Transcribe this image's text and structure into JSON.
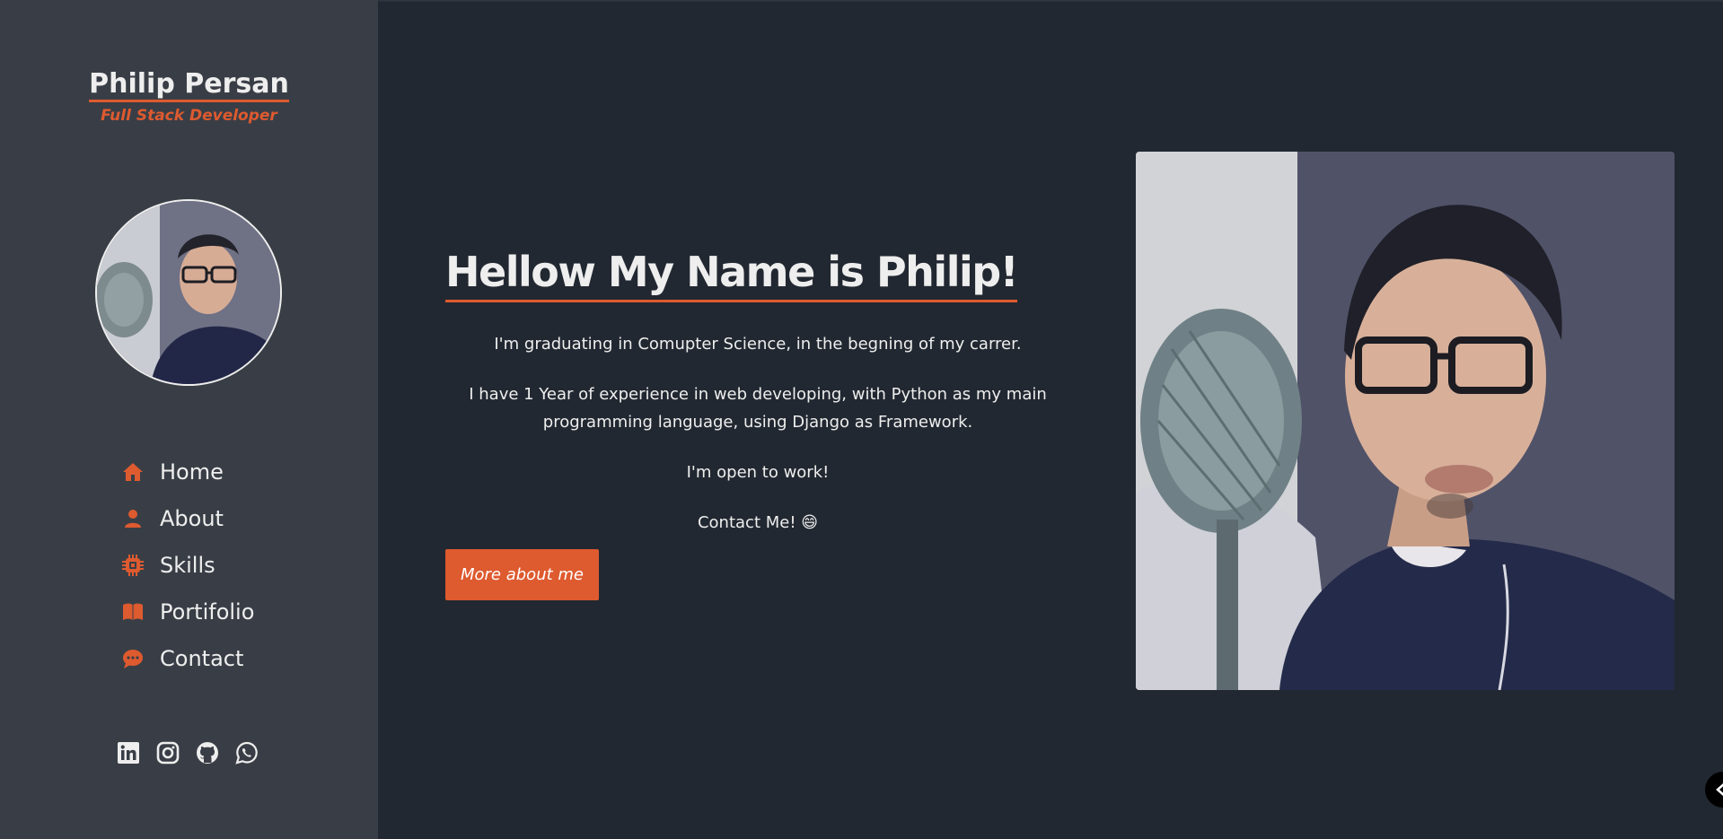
{
  "sidebar": {
    "name": "Philip Persan",
    "role": "Full Stack Developer",
    "nav": [
      {
        "label": "Home",
        "icon": "home-icon"
      },
      {
        "label": "About",
        "icon": "user-icon"
      },
      {
        "label": "Skills",
        "icon": "chip-icon"
      },
      {
        "label": "Portifolio",
        "icon": "book-icon"
      },
      {
        "label": "Contact",
        "icon": "chat-icon"
      }
    ],
    "socials": [
      "linkedin-icon",
      "instagram-icon",
      "github-icon",
      "whatsapp-icon"
    ]
  },
  "hero": {
    "title": "Hellow My Name is Philip!",
    "paragraphs": [
      "I'm graduating in Comupter Science, in the begning of my carrer.",
      "I have 1 Year of experience in web developing, with Python as my main programming language, using Django as Framework.",
      "I'm open to work!",
      "Contact Me! 😄"
    ],
    "button": "More about me"
  },
  "colors": {
    "accent": "#de5a2f",
    "background": "#222831",
    "sidebar": "#393e46",
    "text": "#eeeeee"
  }
}
